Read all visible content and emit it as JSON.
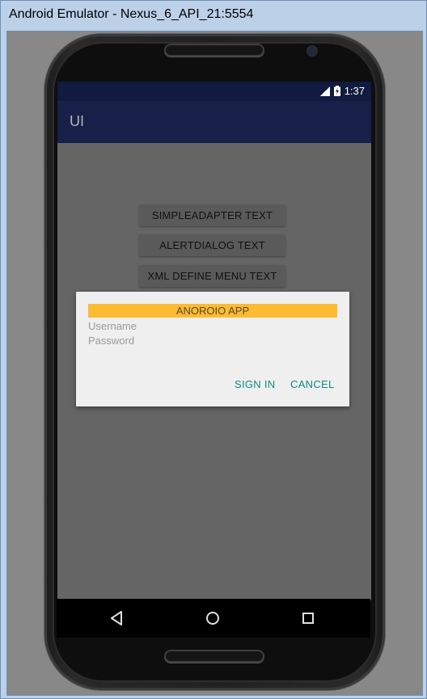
{
  "window": {
    "title": "Android Emulator - Nexus_6_API_21:5554"
  },
  "status_bar": {
    "time": "1:37",
    "icons": [
      "signal-icon",
      "battery-charging-icon"
    ]
  },
  "app_bar": {
    "title": "UI"
  },
  "buttons": [
    {
      "label": "SIMPLEADAPTER TEXT"
    },
    {
      "label": "ALERTDIALOG TEXT"
    },
    {
      "label": "XML DEFINE MENU TEXT"
    }
  ],
  "dialog": {
    "title": "ANOROIO APP",
    "username_hint": "Username",
    "password_hint": "Password",
    "positive_label": "SIGN IN",
    "negative_label": "CANCEL"
  },
  "nav_bar": {
    "icons": [
      "back-icon",
      "home-icon",
      "recents-icon"
    ]
  },
  "colors": {
    "status_bar": "#111a3f",
    "app_bar": "#18204a",
    "dialog_title_bg": "#fdbb34",
    "dialog_action": "#0e8c80",
    "dim_background": "#656565"
  }
}
